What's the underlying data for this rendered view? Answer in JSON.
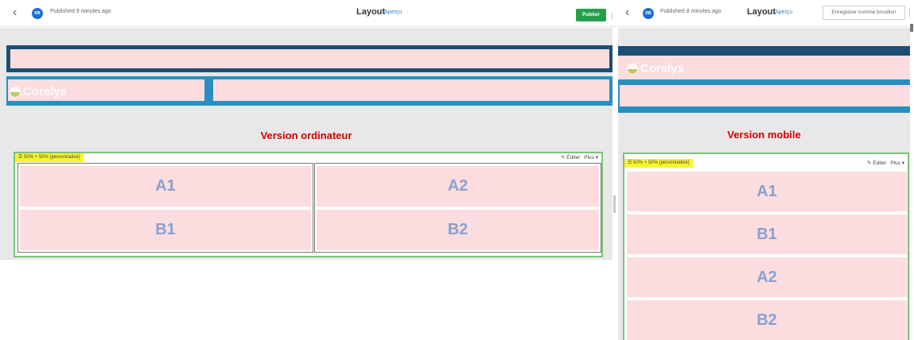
{
  "desktop": {
    "back_glyph": "‹",
    "avatar_initials": "RB",
    "published_text": "Published 9 minutes ago",
    "title": "Layout",
    "preview_link": "Aperçu",
    "publish_button": "Publier",
    "logo_text": "Corelys",
    "version_title": "Version ordinateur",
    "section_tag": "☰ 50% + 50% (personnalisé)",
    "edit_label": "✎ Éditer",
    "more_label": "Plus ▾",
    "cells": {
      "a1": "A1",
      "a2": "A2",
      "b1": "B1",
      "b2": "B2"
    }
  },
  "mobile": {
    "back_glyph": "‹",
    "avatar_initials": "RB",
    "published_text": "Published 8 minutes ago",
    "title": "Layout",
    "preview_link": "Aperçu",
    "draft_button": "Enregistrer comme brouillon",
    "logo_text": "Corelys",
    "version_title": "Version mobile",
    "section_tag": "☰ 50% + 50% (personnalisé)",
    "edit_label": "✎ Éditer",
    "more_label": "Plus ▾",
    "cells": {
      "a1": "A1",
      "b1": "B1",
      "a2": "A2",
      "b2": "B2"
    }
  },
  "colors": {
    "header_dark": "#1d4f74",
    "header_accent": "#2a8fc0",
    "placeholder_pink": "#fbdde0",
    "cell_text": "#8aa0cf",
    "version_red": "#d40000",
    "section_border": "#7bc47b",
    "tag_yellow": "#f6f62a",
    "publish_green": "#25a04a"
  }
}
